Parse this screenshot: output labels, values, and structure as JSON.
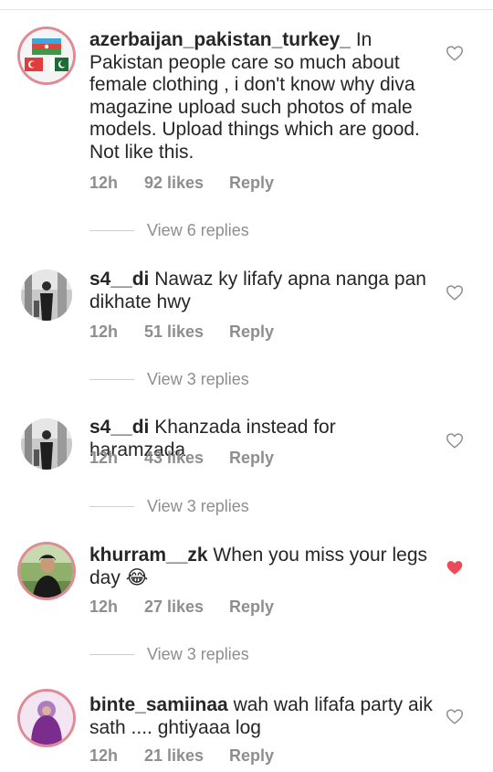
{
  "comments": [
    {
      "username": "azerbaijan_pakistan_turkey_",
      "text": "In Pakistan people care so much about female clothing , i don't know why diva magazine upload such photos of male models.  Upload things which are good. Not like this.",
      "time": "12h",
      "likes": "92 likes",
      "reply": "Reply",
      "liked": false,
      "view_replies": "View 6 replies"
    },
    {
      "username": "s4__di",
      "text": "Nawaz ky lifafy apna nanga pan dikhate hwy",
      "time": "12h",
      "likes": "51 likes",
      "reply": "Reply",
      "liked": false,
      "view_replies": "View 3 replies"
    },
    {
      "username": "s4__di",
      "text": "Khanzada instead for haramzada",
      "time": "12h",
      "likes": "43 likes",
      "reply": "Reply",
      "liked": false,
      "view_replies": "View 3 replies"
    },
    {
      "username": "khurram__zk",
      "text": "When you miss your legs day",
      "emoji": "😂",
      "time": "12h",
      "likes": "27 likes",
      "reply": "Reply",
      "liked": true,
      "view_replies": "View 3 replies"
    },
    {
      "username": "binte_samiinaa",
      "text": "wah wah lifafa party aik sath .... ghtiyaaa log",
      "time": "12h",
      "likes": "21 likes",
      "reply": "Reply",
      "liked": false
    }
  ],
  "colors": {
    "text": "#262626",
    "meta": "#8e8e8e",
    "heart_liked": "#ed4956",
    "story_ring": "#e08a95"
  },
  "icons": {
    "heart_outline": "heart-outline-icon",
    "heart_filled": "heart-filled-icon"
  }
}
